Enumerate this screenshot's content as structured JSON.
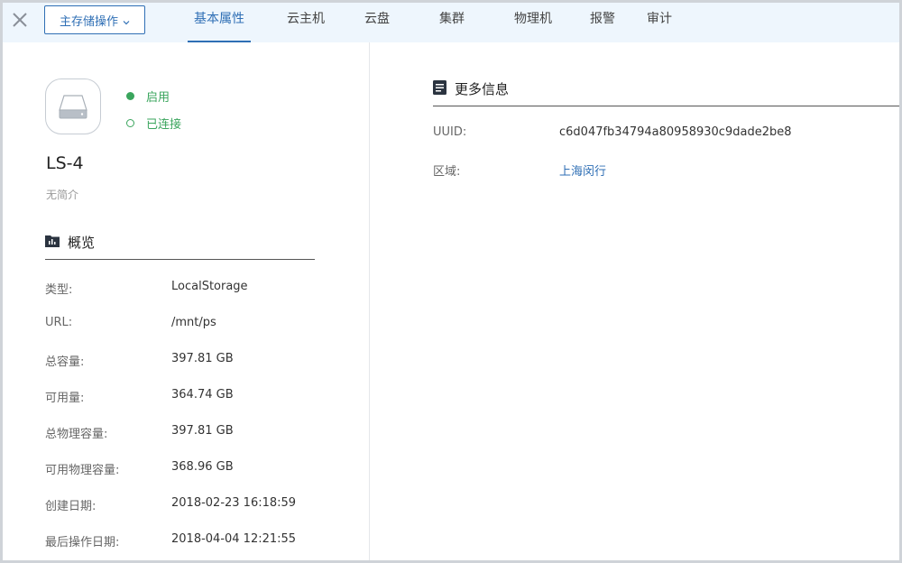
{
  "toolbar": {
    "ops_label": "主存储操作"
  },
  "tabs": [
    {
      "label": "基本属性",
      "active": true
    },
    {
      "label": "云主机"
    },
    {
      "label": "云盘"
    },
    {
      "label": "集群"
    },
    {
      "label": "物理机"
    },
    {
      "label": "报警"
    },
    {
      "label": "审计"
    }
  ],
  "storage": {
    "status_enabled": "启用",
    "status_connected": "已连接",
    "name": "LS-4",
    "description": "无简介"
  },
  "overview": {
    "title": "概览",
    "rows": [
      {
        "label": "类型:",
        "value": "LocalStorage"
      },
      {
        "label": "URL:",
        "value": "/mnt/ps"
      },
      {
        "label": "总容量:",
        "value": "397.81 GB"
      },
      {
        "label": "可用量:",
        "value": "364.74 GB"
      },
      {
        "label": "总物理容量:",
        "value": "397.81 GB"
      },
      {
        "label": "可用物理容量:",
        "value": "368.96 GB"
      },
      {
        "label": "创建日期:",
        "value": "2018-02-23 16:18:59"
      },
      {
        "label": "最后操作日期:",
        "value": "2018-04-04 12:21:55"
      }
    ]
  },
  "more_info": {
    "title": "更多信息",
    "uuid_label": "UUID:",
    "uuid_value": "c6d047fb34794a80958930c9dade2be8",
    "zone_label": "区域:",
    "zone_value": "上海闵行"
  },
  "colors": {
    "accent": "#2f6fb5",
    "status_green": "#3aa55d",
    "topbar_bg": "#eef6fd"
  }
}
